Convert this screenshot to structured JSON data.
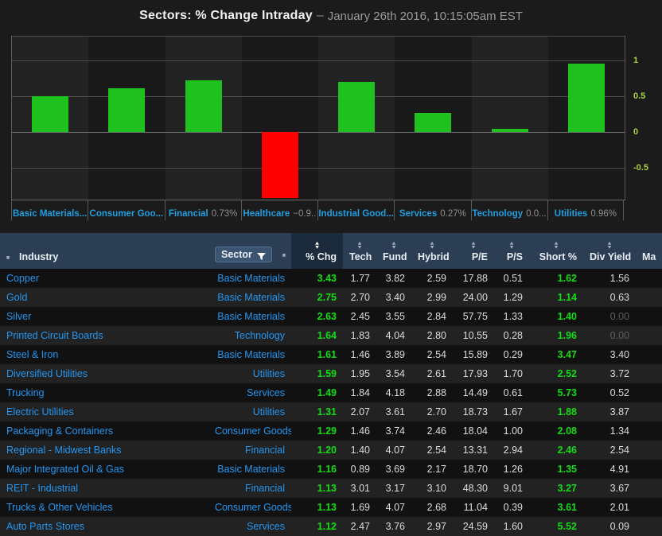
{
  "title": {
    "main": "Sectors: % Change Intraday",
    "dash": "–",
    "sub": "January 26th 2016, 10:15:05am EST"
  },
  "chart_data": {
    "type": "bar",
    "title": "Sectors: % Change Intraday",
    "xlabel": "",
    "ylabel": "",
    "ylim": [
      -0.95,
      1.35
    ],
    "grid": true,
    "yticks": [
      "1",
      "0.5",
      "0",
      "-0.5"
    ],
    "ytick_values": [
      1,
      0.5,
      0,
      -0.5
    ],
    "categories": [
      "Basic Materials...",
      "Consumer Goo...",
      "Financial",
      "Healthcare",
      "Industrial Good...",
      "Services",
      "Technology",
      "Utilities"
    ],
    "category_pcts": [
      "",
      "",
      "0.73%",
      "−0.9..",
      "",
      "0.27%",
      "0.0...",
      "0.96%"
    ],
    "values": [
      0.5,
      0.61,
      0.73,
      -0.93,
      0.7,
      0.27,
      0.04,
      0.96
    ],
    "colors": {
      "positive": "#1fc11f",
      "negative": "#fe0000"
    }
  },
  "table": {
    "columns": [
      {
        "label": "Industry",
        "align": "left",
        "sortable": true,
        "active": false,
        "filter": false
      },
      {
        "label": "Sector",
        "align": "right",
        "sortable": true,
        "active": false,
        "filter": true
      },
      {
        "label": "% Chg",
        "align": "right",
        "sortable": true,
        "active": true,
        "filter": false
      },
      {
        "label": "Tech",
        "align": "right",
        "sortable": true,
        "active": false,
        "filter": false
      },
      {
        "label": "Fund",
        "align": "right",
        "sortable": true,
        "active": false,
        "filter": false
      },
      {
        "label": "Hybrid",
        "align": "right",
        "sortable": true,
        "active": false,
        "filter": false
      },
      {
        "label": "P/E",
        "align": "right",
        "sortable": true,
        "active": false,
        "filter": false
      },
      {
        "label": "P/S",
        "align": "right",
        "sortable": true,
        "active": false,
        "filter": false
      },
      {
        "label": "Short %",
        "align": "right",
        "sortable": true,
        "active": false,
        "filter": false
      },
      {
        "label": "Div Yield",
        "align": "right",
        "sortable": true,
        "active": false,
        "filter": false
      },
      {
        "label": "Ma",
        "align": "right",
        "sortable": false,
        "active": false,
        "filter": false
      }
    ],
    "rows": [
      {
        "industry": "Copper",
        "sector": "Basic Materials",
        "chg": "3.43",
        "tech": "1.77",
        "fund": "3.82",
        "hybrid": "2.59",
        "pe": "17.88",
        "ps": "0.51",
        "short": "1.62",
        "div": "1.56",
        "div_dim": false
      },
      {
        "industry": "Gold",
        "sector": "Basic Materials",
        "chg": "2.75",
        "tech": "2.70",
        "fund": "3.40",
        "hybrid": "2.99",
        "pe": "24.00",
        "ps": "1.29",
        "short": "1.14",
        "div": "0.63",
        "div_dim": false
      },
      {
        "industry": "Silver",
        "sector": "Basic Materials",
        "chg": "2.63",
        "tech": "2.45",
        "fund": "3.55",
        "hybrid": "2.84",
        "pe": "57.75",
        "ps": "1.33",
        "short": "1.40",
        "div": "0.00",
        "div_dim": true
      },
      {
        "industry": "Printed Circuit Boards",
        "sector": "Technology",
        "chg": "1.64",
        "tech": "1.83",
        "fund": "4.04",
        "hybrid": "2.80",
        "pe": "10.55",
        "ps": "0.28",
        "short": "1.96",
        "div": "0.00",
        "div_dim": true
      },
      {
        "industry": "Steel & Iron",
        "sector": "Basic Materials",
        "chg": "1.61",
        "tech": "1.46",
        "fund": "3.89",
        "hybrid": "2.54",
        "pe": "15.89",
        "ps": "0.29",
        "short": "3.47",
        "div": "3.40",
        "div_dim": false
      },
      {
        "industry": "Diversified Utilities",
        "sector": "Utilities",
        "chg": "1.59",
        "tech": "1.95",
        "fund": "3.54",
        "hybrid": "2.61",
        "pe": "17.93",
        "ps": "1.70",
        "short": "2.52",
        "div": "3.72",
        "div_dim": false
      },
      {
        "industry": "Trucking",
        "sector": "Services",
        "chg": "1.49",
        "tech": "1.84",
        "fund": "4.18",
        "hybrid": "2.88",
        "pe": "14.49",
        "ps": "0.61",
        "short": "5.73",
        "div": "0.52",
        "div_dim": false
      },
      {
        "industry": "Electric Utilities",
        "sector": "Utilities",
        "chg": "1.31",
        "tech": "2.07",
        "fund": "3.61",
        "hybrid": "2.70",
        "pe": "18.73",
        "ps": "1.67",
        "short": "1.88",
        "div": "3.87",
        "div_dim": false
      },
      {
        "industry": "Packaging & Containers",
        "sector": "Consumer Goods",
        "chg": "1.29",
        "tech": "1.46",
        "fund": "3.74",
        "hybrid": "2.46",
        "pe": "18.04",
        "ps": "1.00",
        "short": "2.08",
        "div": "1.34",
        "div_dim": false
      },
      {
        "industry": "Regional - Midwest Banks",
        "sector": "Financial",
        "chg": "1.20",
        "tech": "1.40",
        "fund": "4.07",
        "hybrid": "2.54",
        "pe": "13.31",
        "ps": "2.94",
        "short": "2.46",
        "div": "2.54",
        "div_dim": false
      },
      {
        "industry": "Major Integrated Oil & Gas",
        "sector": "Basic Materials",
        "chg": "1.16",
        "tech": "0.89",
        "fund": "3.69",
        "hybrid": "2.17",
        "pe": "18.70",
        "ps": "1.26",
        "short": "1.35",
        "div": "4.91",
        "div_dim": false
      },
      {
        "industry": "REIT - Industrial",
        "sector": "Financial",
        "chg": "1.13",
        "tech": "3.01",
        "fund": "3.17",
        "hybrid": "3.10",
        "pe": "48.30",
        "ps": "9.01",
        "short": "3.27",
        "div": "3.67",
        "div_dim": false
      },
      {
        "industry": "Trucks & Other Vehicles",
        "sector": "Consumer Goods",
        "chg": "1.13",
        "tech": "1.69",
        "fund": "4.07",
        "hybrid": "2.68",
        "pe": "11.04",
        "ps": "0.39",
        "short": "3.61",
        "div": "2.01",
        "div_dim": false
      },
      {
        "industry": "Auto Parts Stores",
        "sector": "Services",
        "chg": "1.12",
        "tech": "2.47",
        "fund": "3.76",
        "hybrid": "2.97",
        "pe": "24.59",
        "ps": "1.60",
        "short": "5.52",
        "div": "0.09",
        "div_dim": false
      }
    ]
  }
}
